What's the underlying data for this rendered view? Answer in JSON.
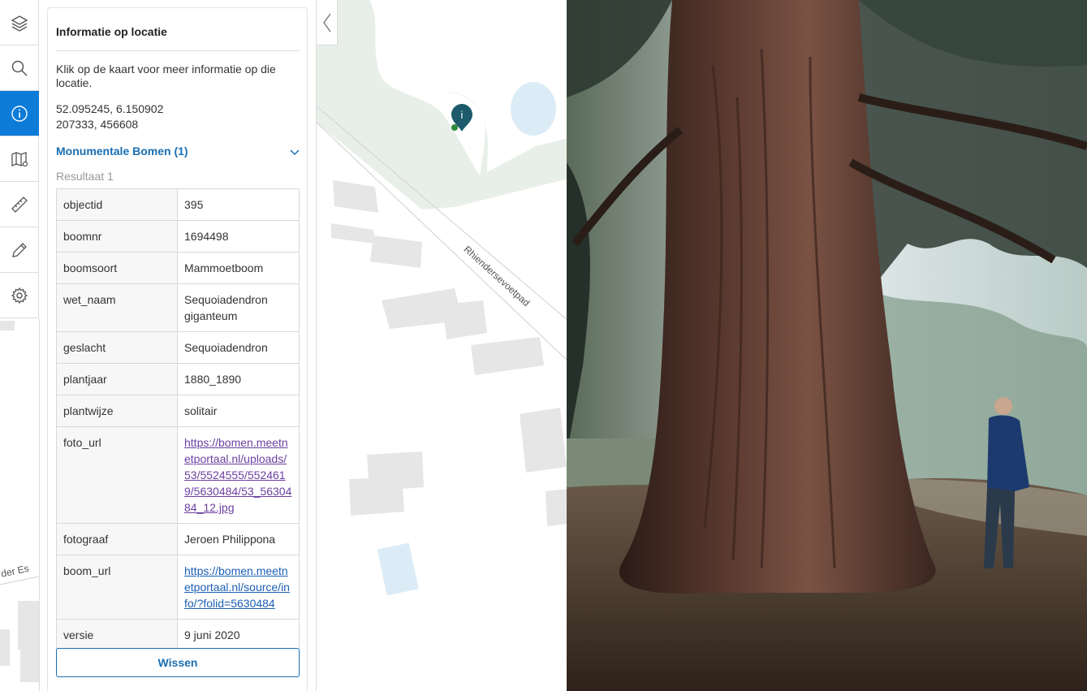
{
  "toolbar": {
    "tools": [
      {
        "icon": "layers-icon"
      },
      {
        "icon": "search-icon"
      },
      {
        "icon": "info-icon",
        "active": true
      },
      {
        "icon": "map-legend-icon"
      },
      {
        "icon": "ruler-icon"
      },
      {
        "icon": "pencil-icon"
      },
      {
        "icon": "settings-icon"
      }
    ]
  },
  "panel": {
    "title": "Informatie op locatie",
    "intro": "Klik op de kaart voor meer informatie op die locatie.",
    "coords_wgs84": "52.095245, 6.150902",
    "coords_rd": "207333, 456608",
    "section_title": "Monumentale Bomen (1)",
    "result_label": "Resultaat 1",
    "rows": [
      {
        "key": "objectid",
        "value": "395"
      },
      {
        "key": "boomnr",
        "value": "1694498"
      },
      {
        "key": "boomsoort",
        "value": "Mammoetboom"
      },
      {
        "key": "wet_naam",
        "value": "Sequoiadendron giganteum"
      },
      {
        "key": "geslacht",
        "value": "Sequoiadendron"
      },
      {
        "key": "plantjaar",
        "value": "1880_1890"
      },
      {
        "key": "plantwijze",
        "value": "solitair"
      },
      {
        "key": "foto_url",
        "value": "https://bomen.meetnetportaal.nl/uploads/53/5524555/5524619/5630484/53_5630484_12.jpg",
        "link": true,
        "visited": true
      },
      {
        "key": "fotograaf",
        "value": "Jeroen Philippona"
      },
      {
        "key": "boom_url",
        "value": "https://bomen.meetnetportaal.nl/source/info/?folid=5630484",
        "link": true
      },
      {
        "key": "versie",
        "value": "9 juni 2020"
      }
    ],
    "clear_button": "Wissen"
  },
  "map": {
    "road_label_1": "Rhiendersevoetpad",
    "road_label_2": "der Es",
    "marker_label": "i",
    "colors": {
      "green": "#e8efe8",
      "building": "#e6e6e6",
      "water": "#dcecf7",
      "marker": "#1d5a6b"
    }
  },
  "photo": {
    "icon": "tree-photo"
  },
  "colors": {
    "accent": "#0d7bd8",
    "link": "#1a6fb3"
  }
}
